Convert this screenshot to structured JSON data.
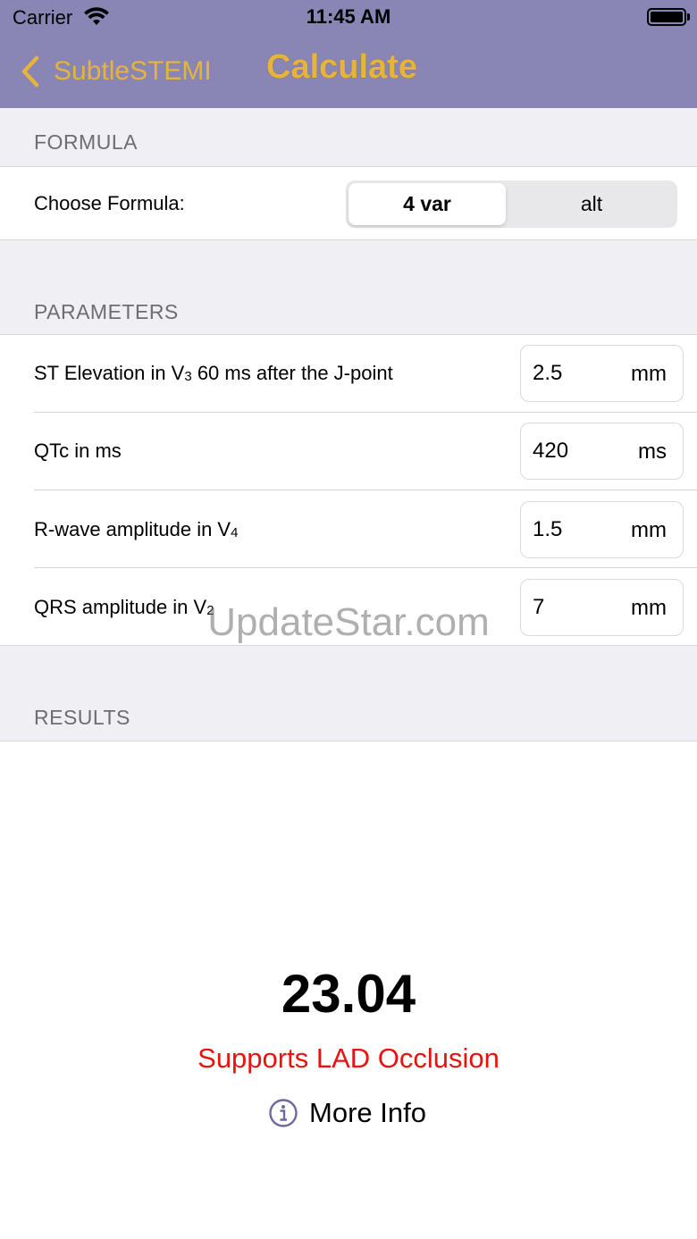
{
  "status_bar": {
    "carrier": "Carrier",
    "time": "11:45 AM"
  },
  "nav": {
    "back_label": "SubtleSTEMI",
    "title": "Calculate"
  },
  "formula": {
    "section_title": "FORMULA",
    "label": "Choose Formula:",
    "options": [
      "4 var",
      "alt"
    ],
    "selected": "4 var"
  },
  "parameters": {
    "section_title": "PARAMETERS",
    "rows": [
      {
        "label_pre": "ST Elevation in V",
        "label_sub": "3",
        "label_post": " 60 ms after the J-point",
        "value": "2.5",
        "unit": "mm"
      },
      {
        "label_pre": "QTc in ms",
        "label_sub": "",
        "label_post": "",
        "value": "420",
        "unit": "ms"
      },
      {
        "label_pre": "R-wave amplitude in V",
        "label_sub": "4",
        "label_post": "",
        "value": "1.5",
        "unit": "mm"
      },
      {
        "label_pre": "QRS amplitude in V",
        "label_sub": "2",
        "label_post": "",
        "value": "7",
        "unit": "mm"
      }
    ]
  },
  "results": {
    "section_title": "RESULTS",
    "value": "23.04",
    "interpretation": "Supports LAD Occlusion",
    "more_info_label": "More Info"
  },
  "watermark": "UpdateStar.com",
  "colors": {
    "nav_bar": "#8985b4",
    "accent": "#e6b43a",
    "result_alert": "#e8130d",
    "info_icon": "#6a6aa0"
  }
}
